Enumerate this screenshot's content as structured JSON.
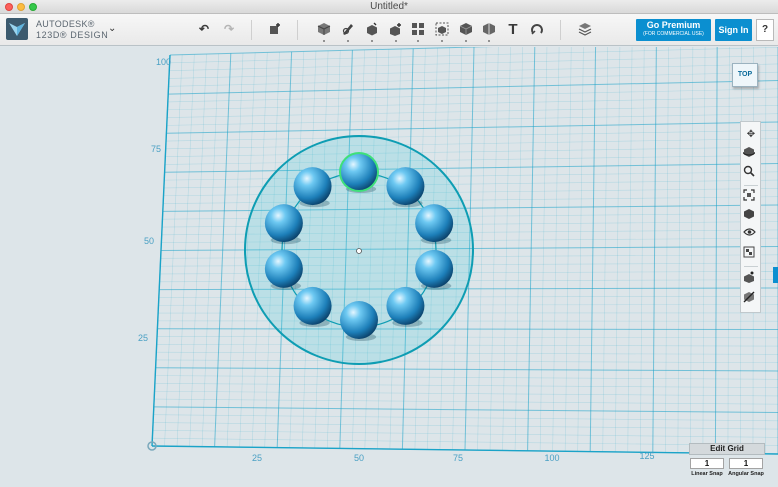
{
  "window": {
    "title": "Untitled*"
  },
  "brand": {
    "line1": "AUTODESK®",
    "line2": "123D® DESIGN",
    "menu_icon": "chevron-down-icon"
  },
  "toolbar": {
    "icons": [
      "undo-icon",
      "redo-icon",
      "transform-box-icon",
      "primitives-cube-icon",
      "sketch-icon",
      "construct-icon",
      "modify-icon",
      "pattern-icon",
      "grouping-icon",
      "combine-icon",
      "measure-icon",
      "text-icon",
      "snap-icon",
      "material-icon"
    ],
    "text_glyph": "T",
    "premium_label": "Go Premium",
    "premium_sub": "(FOR COMMERCIAL USE)",
    "signin_label": "Sign In",
    "help_label": "?"
  },
  "viewcube": {
    "label": "TOP"
  },
  "grid": {
    "x_labels": [
      "25",
      "50",
      "75",
      "100",
      "125"
    ],
    "y_labels": [
      "100",
      "75",
      "50",
      "25"
    ],
    "accent_color": "#1aa3c8"
  },
  "navpanel": {
    "icons": [
      "pan-icon",
      "orbit-icon",
      "zoom-icon",
      "fit-icon",
      "views-icon",
      "visibility-icon",
      "material-view-icon",
      "snap-grid-icon",
      "solid-toggle-icon"
    ]
  },
  "edit_grid": {
    "button_label": "Edit Grid",
    "linear_snap_value": "1",
    "angular_snap_value": "1",
    "linear_snap_label": "Linear Snap",
    "angular_snap_label": "Angular Snap"
  },
  "scene": {
    "sphere_count": 10,
    "selected_sphere_index": 0
  }
}
